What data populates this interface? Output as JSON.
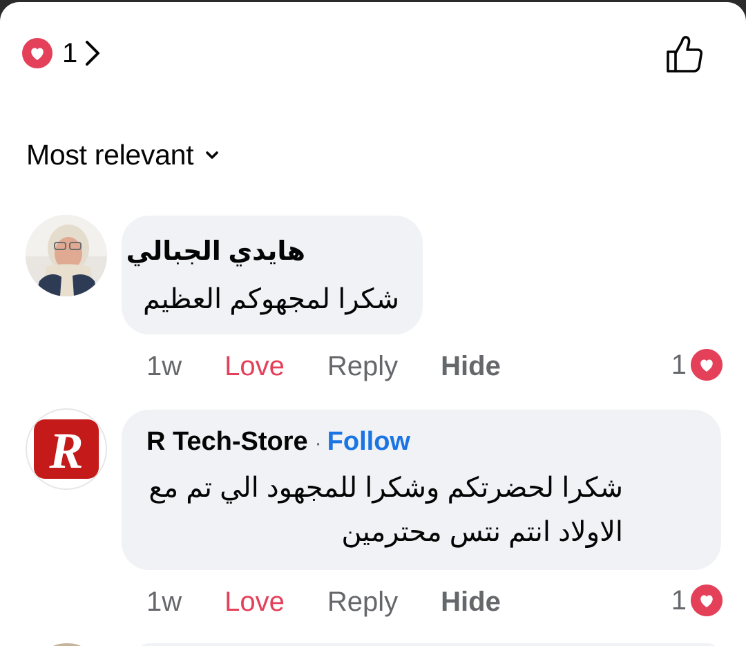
{
  "header": {
    "reaction_count": "1",
    "reaction_icon": "heart-icon",
    "like_icon": "thumbs-up-icon"
  },
  "sort": {
    "label": "Most relevant"
  },
  "comments": [
    {
      "author": "هايدي الجبالي",
      "text_lines": [
        "شكرا لمجهوكم العظيم"
      ],
      "time": "1w",
      "love_label": "Love",
      "reply_label": "Reply",
      "hide_label": "Hide",
      "reaction_count": "1"
    },
    {
      "author": "R Tech-Store",
      "separator": "·",
      "follow_label": "Follow",
      "text_lines": [
        "شكرا لحضرتكم وشكرا للمجهود الي تم مع",
        "الاولاد انتم نتس محترمين"
      ],
      "time": "1w",
      "love_label": "Love",
      "reply_label": "Reply",
      "hide_label": "Hide",
      "reaction_count": "1"
    }
  ],
  "colors": {
    "love": "#e4405a",
    "follow": "#1b74e4",
    "bubble": "#f0f2f5",
    "secondary_text": "#65676b"
  }
}
